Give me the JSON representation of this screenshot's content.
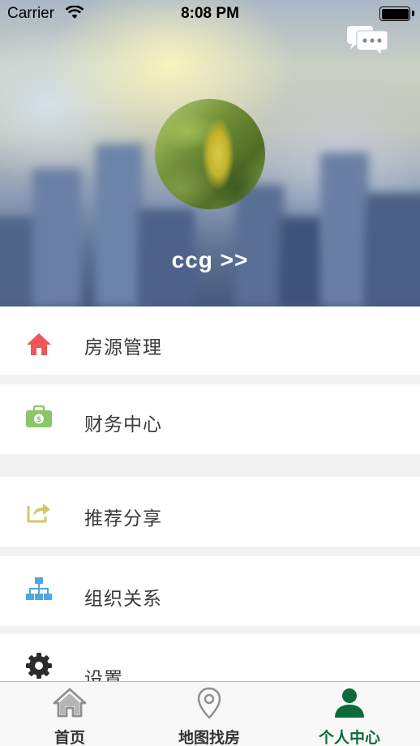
{
  "status_bar": {
    "carrier": "Carrier",
    "time": "8:08 PM"
  },
  "profile": {
    "username": "ccg >>",
    "message_icon": "chat-bubbles-icon"
  },
  "menu": {
    "items": [
      {
        "label": "房源管理",
        "icon": "house-icon",
        "color": "#ef5658"
      },
      {
        "label": "财务中心",
        "icon": "money-bag-icon",
        "color": "#8cc56a"
      },
      {
        "label": "推荐分享",
        "icon": "share-icon",
        "color": "#d6c56a"
      },
      {
        "label": "组织关系",
        "icon": "org-chart-icon",
        "color": "#4fa7e0"
      },
      {
        "label": "设置",
        "icon": "gear-icon",
        "color": "#2b2b2b"
      }
    ]
  },
  "tabbar": {
    "tabs": [
      {
        "label": "首页",
        "icon": "home-icon",
        "active": false
      },
      {
        "label": "地图找房",
        "icon": "map-pin-icon",
        "active": false
      },
      {
        "label": "个人中心",
        "icon": "person-icon",
        "active": true
      }
    ],
    "active_color": "#0c6b3a",
    "inactive_color": "#999999"
  }
}
